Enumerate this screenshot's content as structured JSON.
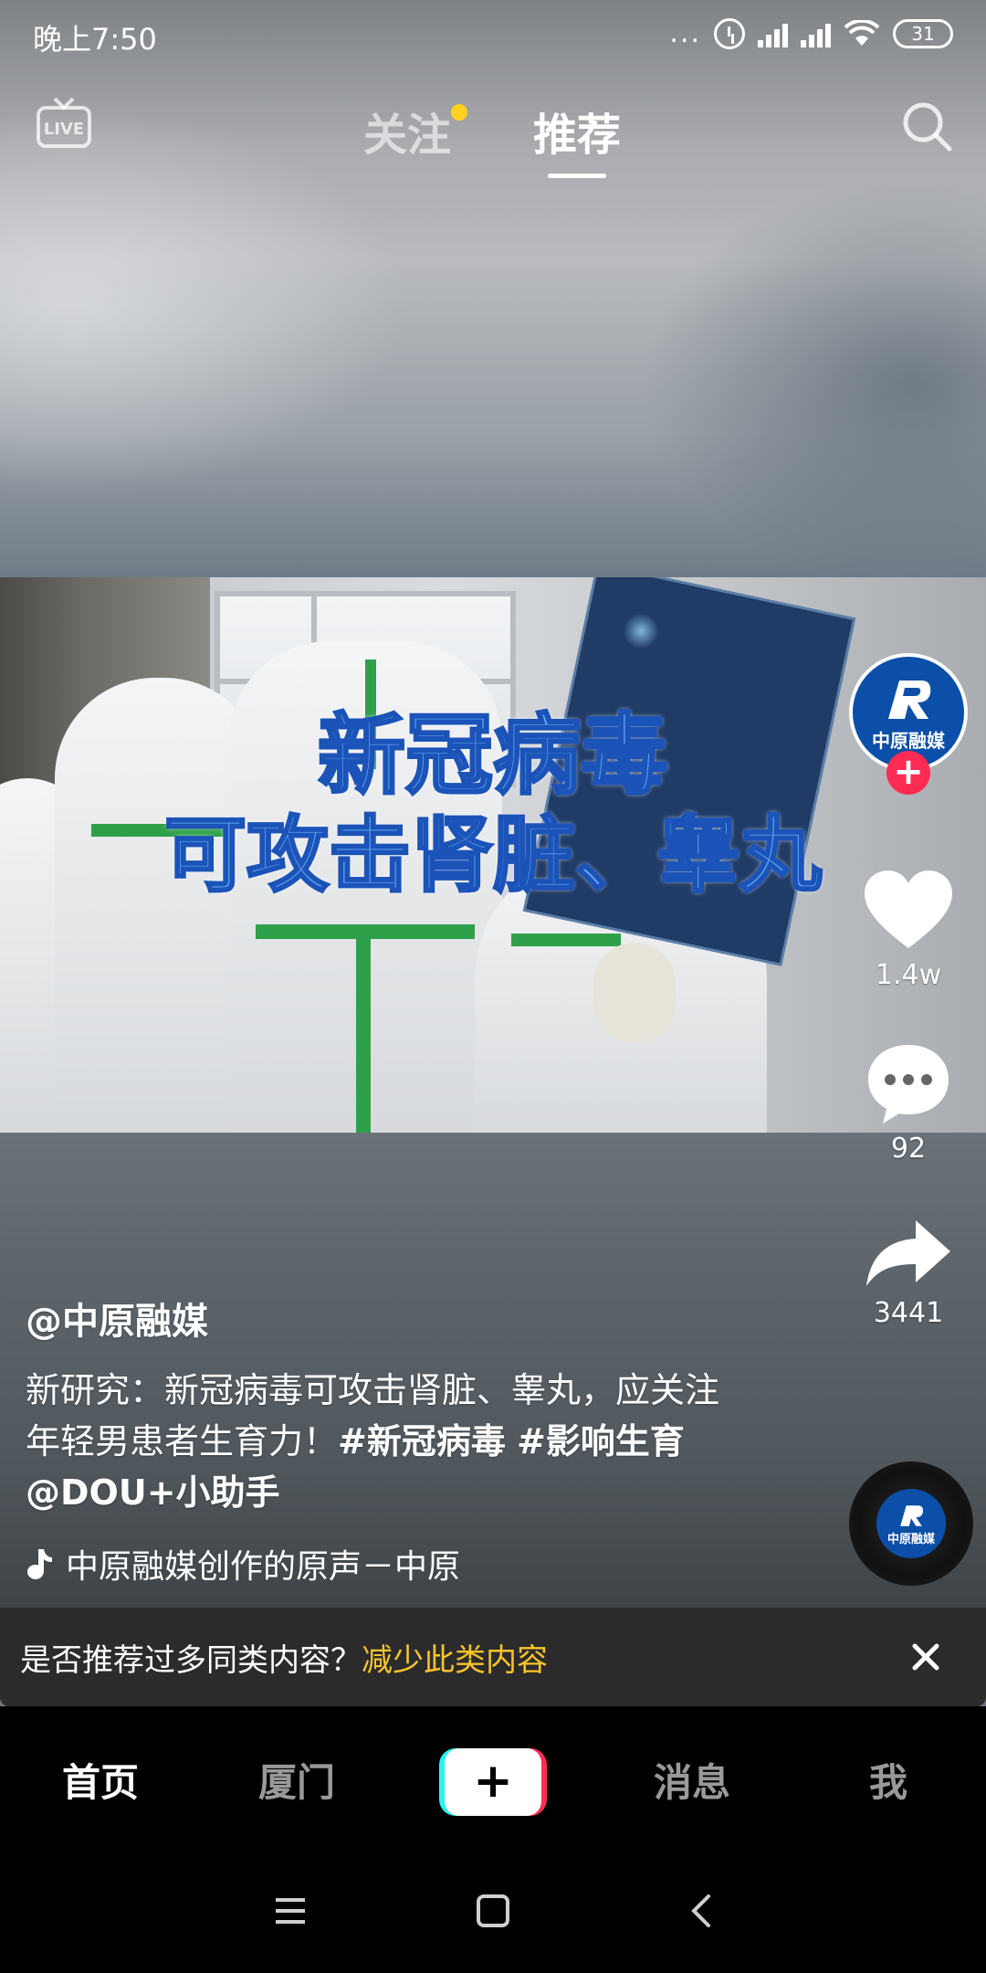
{
  "status_bar": {
    "time": "晚上7:50",
    "dots": "...",
    "battery": "31"
  },
  "top_nav": {
    "live_label": "LIVE",
    "tabs": [
      {
        "label": "关注"
      },
      {
        "label": "推荐"
      }
    ]
  },
  "video": {
    "overlay_line1": "新冠病毒",
    "overlay_line2": "可攻击肾脏、睾丸"
  },
  "rail": {
    "avatar_name": "中原融媒",
    "follow_symbol": "+",
    "likes": "1.4w",
    "comments": "92",
    "shares": "3441"
  },
  "caption": {
    "author": "@中原融媒",
    "text": "新研究：新冠病毒可攻击肾脏、睾丸，应关注年轻男患者生育力！",
    "tag1": "#新冠病毒",
    "tag2": "#影响生育",
    "mention": "@DOU+小助手"
  },
  "music": {
    "title": "中原融媒创作的原声－中原"
  },
  "disc": {
    "label": "中原融媒"
  },
  "feedback": {
    "question": "是否推荐过多同类内容？",
    "link": "减少此类内容"
  },
  "bottom_nav": {
    "home": "首页",
    "city": "厦门",
    "create": "+",
    "messages": "消息",
    "me": "我"
  },
  "colors": {
    "accent_red": "#fe2c55",
    "accent_cyan": "#25f4ee",
    "link_yellow": "#f8c42c",
    "badge_yellow": "#ffd21e"
  }
}
